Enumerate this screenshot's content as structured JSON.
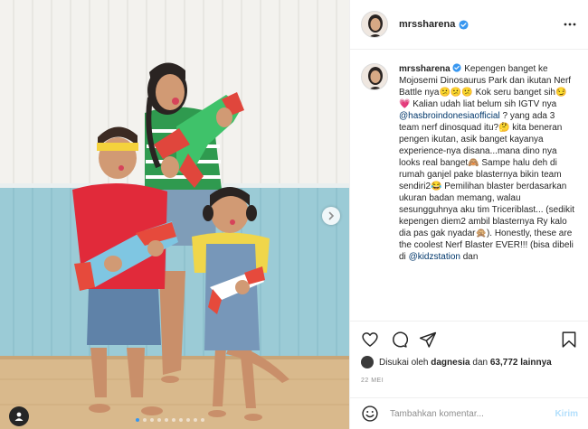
{
  "post": {
    "username": "mrssharena",
    "verified": true
  },
  "caption": {
    "username": "mrssharena",
    "text_1": "Kepengen banget ke Mojosemi Dinosaurus Park dan ikutan Nerf Battle nya😕😕😕 Kok seru banget sih😏💗 Kalian udah liat belum sih IGTV nya ",
    "mention_1": "@hasbroindonesiaofficial",
    "text_2": " ? yang ada 3 team nerf dinosquad itu?🤔 kita beneran pengen ikutan, asik banget kayanya experience-nya disana...mana dino nya looks real banget🙈 Sampe halu deh di rumah ganjel pake blasternya bikin team sendiri2😂 Pemilihan blaster berdasarkan ukuran badan memang, walau sesungguhnya aku tim Triceriblast... (sedikit kepengen diem2 ambil blasternya Ry kalo dia pas gak nyadar🙊). Honestly, these are the coolest Nerf Blaster EVER!!! (bisa dibeli di ",
    "mention_2": "@kidzstation",
    "text_3": " dan"
  },
  "likes": {
    "prefix": "Disukai oleh ",
    "user": "dagnesia",
    "middle": " dan ",
    "count": "63,772 lainnya"
  },
  "date": "22 MEI",
  "comment": {
    "placeholder": "Tambahkan komentar...",
    "send_label": "Kirim"
  },
  "carousel": {
    "total": 10,
    "active_index": 0
  },
  "colors": {
    "verified_blue": "#3897f0",
    "send_disabled": "#b2dffc",
    "mention": "#00376b",
    "muted": "#8e8e8e"
  },
  "icons": [
    "verified-icon",
    "more-options-icon",
    "heart-icon",
    "comment-icon",
    "share-icon",
    "bookmark-icon",
    "next-arrow-icon",
    "tag-user-icon",
    "emoji-icon"
  ]
}
